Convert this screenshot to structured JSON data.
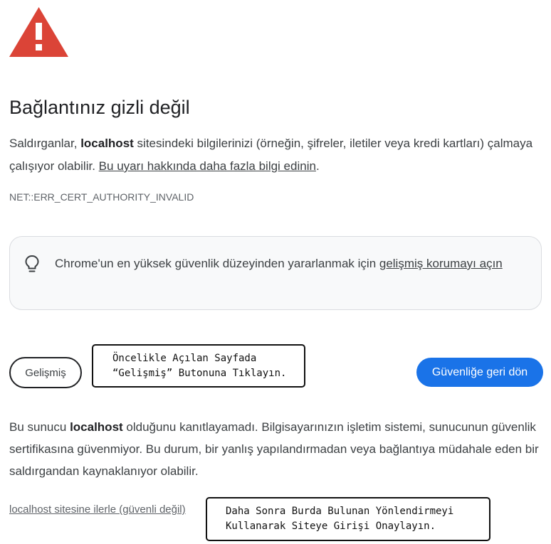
{
  "heading": "Bağlantınız gizli değil",
  "intro": {
    "before": "Saldırganlar, ",
    "host": "localhost",
    "after": " sitesindeki bilgilerinizi (örneğin, şifreler, iletiler veya kredi kartları) çalmaya çalışıyor olabilir. ",
    "learn_more": "Bu uyarı hakkında daha fazla bilgi edinin",
    "end": "."
  },
  "error_code": "NET::ERR_CERT_AUTHORITY_INVALID",
  "protection_promo": {
    "text": "Chrome'un en yüksek güvenlik düzeyinden yararlanmak için ",
    "link": "gelişmiş korumayı açın"
  },
  "buttons": {
    "advanced": "Gelişmiş",
    "back_to_safety": "Güvenliğe geri dön"
  },
  "annotations": {
    "step1": "Öncelikle Açılan Sayfada\n“Gelişmiş” Butonuna Tıklayın.",
    "step2": "Daha Sonra Burda Bulunan Yönlendirmeyi\nKullanarak Siteye Girişi Onaylayın."
  },
  "details": {
    "before": "Bu sunucu ",
    "host": "localhost",
    "after": " olduğunu kanıtlayamadı. Bilgisayarınızın işletim sistemi, sunucunun güvenlik sertifikasına güvenmiyor. Bu durum, bir yanlış yapılandırmadan veya bağlantıya müdahale eden bir saldırgandan kaynaklanıyor olabilir."
  },
  "proceed_link": "localhost sitesine ilerle (güvenli değil)",
  "icons": {
    "warning": "warning-triangle-icon",
    "bulb": "lightbulb-icon"
  },
  "colors": {
    "warning_red": "#db4437",
    "primary_blue": "#1a73e8",
    "text": "#202124"
  }
}
